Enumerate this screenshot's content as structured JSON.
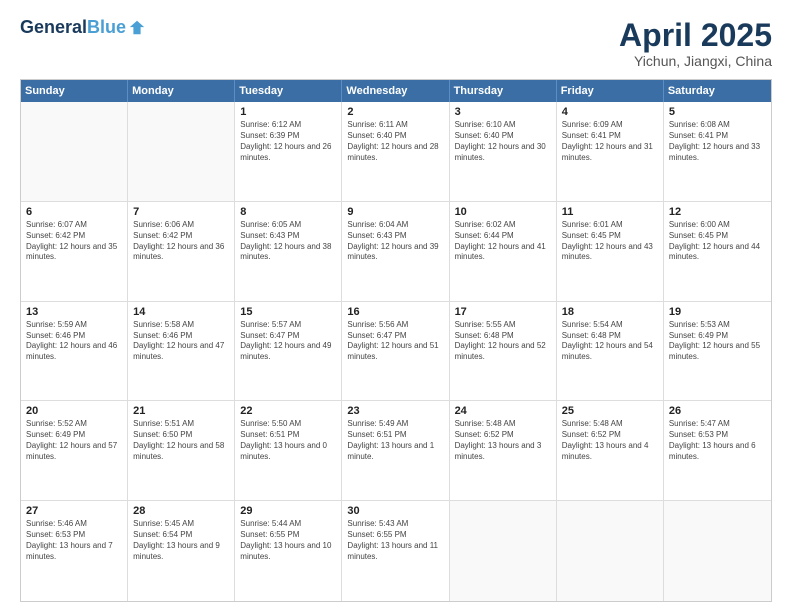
{
  "header": {
    "logo_line1": "General",
    "logo_line2": "Blue",
    "title": "April 2025",
    "subtitle": "Yichun, Jiangxi, China"
  },
  "calendar": {
    "days_of_week": [
      "Sunday",
      "Monday",
      "Tuesday",
      "Wednesday",
      "Thursday",
      "Friday",
      "Saturday"
    ],
    "weeks": [
      [
        {
          "day": "",
          "empty": true
        },
        {
          "day": "",
          "empty": true
        },
        {
          "day": "1",
          "sunrise": "6:12 AM",
          "sunset": "6:39 PM",
          "daylight": "12 hours and 26 minutes."
        },
        {
          "day": "2",
          "sunrise": "6:11 AM",
          "sunset": "6:40 PM",
          "daylight": "12 hours and 28 minutes."
        },
        {
          "day": "3",
          "sunrise": "6:10 AM",
          "sunset": "6:40 PM",
          "daylight": "12 hours and 30 minutes."
        },
        {
          "day": "4",
          "sunrise": "6:09 AM",
          "sunset": "6:41 PM",
          "daylight": "12 hours and 31 minutes."
        },
        {
          "day": "5",
          "sunrise": "6:08 AM",
          "sunset": "6:41 PM",
          "daylight": "12 hours and 33 minutes."
        }
      ],
      [
        {
          "day": "6",
          "sunrise": "6:07 AM",
          "sunset": "6:42 PM",
          "daylight": "12 hours and 35 minutes."
        },
        {
          "day": "7",
          "sunrise": "6:06 AM",
          "sunset": "6:42 PM",
          "daylight": "12 hours and 36 minutes."
        },
        {
          "day": "8",
          "sunrise": "6:05 AM",
          "sunset": "6:43 PM",
          "daylight": "12 hours and 38 minutes."
        },
        {
          "day": "9",
          "sunrise": "6:04 AM",
          "sunset": "6:43 PM",
          "daylight": "12 hours and 39 minutes."
        },
        {
          "day": "10",
          "sunrise": "6:02 AM",
          "sunset": "6:44 PM",
          "daylight": "12 hours and 41 minutes."
        },
        {
          "day": "11",
          "sunrise": "6:01 AM",
          "sunset": "6:45 PM",
          "daylight": "12 hours and 43 minutes."
        },
        {
          "day": "12",
          "sunrise": "6:00 AM",
          "sunset": "6:45 PM",
          "daylight": "12 hours and 44 minutes."
        }
      ],
      [
        {
          "day": "13",
          "sunrise": "5:59 AM",
          "sunset": "6:46 PM",
          "daylight": "12 hours and 46 minutes."
        },
        {
          "day": "14",
          "sunrise": "5:58 AM",
          "sunset": "6:46 PM",
          "daylight": "12 hours and 47 minutes."
        },
        {
          "day": "15",
          "sunrise": "5:57 AM",
          "sunset": "6:47 PM",
          "daylight": "12 hours and 49 minutes."
        },
        {
          "day": "16",
          "sunrise": "5:56 AM",
          "sunset": "6:47 PM",
          "daylight": "12 hours and 51 minutes."
        },
        {
          "day": "17",
          "sunrise": "5:55 AM",
          "sunset": "6:48 PM",
          "daylight": "12 hours and 52 minutes."
        },
        {
          "day": "18",
          "sunrise": "5:54 AM",
          "sunset": "6:48 PM",
          "daylight": "12 hours and 54 minutes."
        },
        {
          "day": "19",
          "sunrise": "5:53 AM",
          "sunset": "6:49 PM",
          "daylight": "12 hours and 55 minutes."
        }
      ],
      [
        {
          "day": "20",
          "sunrise": "5:52 AM",
          "sunset": "6:49 PM",
          "daylight": "12 hours and 57 minutes."
        },
        {
          "day": "21",
          "sunrise": "5:51 AM",
          "sunset": "6:50 PM",
          "daylight": "12 hours and 58 minutes."
        },
        {
          "day": "22",
          "sunrise": "5:50 AM",
          "sunset": "6:51 PM",
          "daylight": "13 hours and 0 minutes."
        },
        {
          "day": "23",
          "sunrise": "5:49 AM",
          "sunset": "6:51 PM",
          "daylight": "13 hours and 1 minute."
        },
        {
          "day": "24",
          "sunrise": "5:48 AM",
          "sunset": "6:52 PM",
          "daylight": "13 hours and 3 minutes."
        },
        {
          "day": "25",
          "sunrise": "5:48 AM",
          "sunset": "6:52 PM",
          "daylight": "13 hours and 4 minutes."
        },
        {
          "day": "26",
          "sunrise": "5:47 AM",
          "sunset": "6:53 PM",
          "daylight": "13 hours and 6 minutes."
        }
      ],
      [
        {
          "day": "27",
          "sunrise": "5:46 AM",
          "sunset": "6:53 PM",
          "daylight": "13 hours and 7 minutes."
        },
        {
          "day": "28",
          "sunrise": "5:45 AM",
          "sunset": "6:54 PM",
          "daylight": "13 hours and 9 minutes."
        },
        {
          "day": "29",
          "sunrise": "5:44 AM",
          "sunset": "6:55 PM",
          "daylight": "13 hours and 10 minutes."
        },
        {
          "day": "30",
          "sunrise": "5:43 AM",
          "sunset": "6:55 PM",
          "daylight": "13 hours and 11 minutes."
        },
        {
          "day": "",
          "empty": true
        },
        {
          "day": "",
          "empty": true
        },
        {
          "day": "",
          "empty": true
        }
      ]
    ]
  }
}
